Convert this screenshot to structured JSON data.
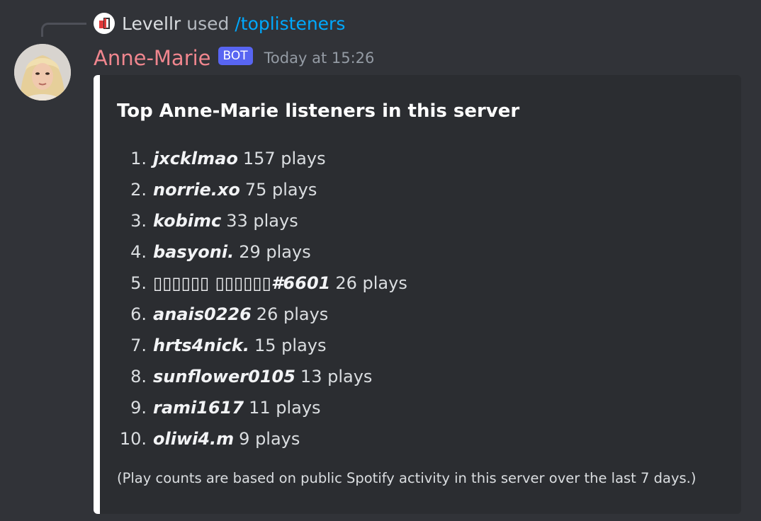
{
  "interaction": {
    "user": "Levellr",
    "verb": "used",
    "command": "/toplisteners"
  },
  "message": {
    "author": "Anne-Marie",
    "badge": "BOT",
    "timestamp": "Today at 15:26"
  },
  "embed": {
    "accent_color": "#ffffff",
    "title": "Top Anne-Marie listeners in this server",
    "entries": [
      {
        "rank": "1.",
        "user": "jxcklmao",
        "plays": "157 plays"
      },
      {
        "rank": "2.",
        "user": "norrie.xo",
        "plays": "75 plays"
      },
      {
        "rank": "3.",
        "user": "kobimc",
        "plays": "33 plays"
      },
      {
        "rank": "4.",
        "user": "basyoni.",
        "plays": "29 plays"
      },
      {
        "rank": "5.",
        "user": "▯▯▯▯▯▯ ▯▯▯▯▯▯#6601",
        "plays": "26 plays"
      },
      {
        "rank": "6.",
        "user": "anais0226",
        "plays": "26 plays"
      },
      {
        "rank": "7.",
        "user": "hrts4nick.",
        "plays": "15 plays"
      },
      {
        "rank": "8.",
        "user": "sunflower0105",
        "plays": "13 plays"
      },
      {
        "rank": "9.",
        "user": "rami1617",
        "plays": "11 plays"
      },
      {
        "rank": "10.",
        "user": "oliwi4.m",
        "plays": "9 plays"
      }
    ],
    "footer_note": "(Play counts are based on public Spotify activity in this server over the last 7 days.)"
  },
  "colors": {
    "background": "#313338",
    "embed_background": "#2b2d31",
    "author_name": "#f0868e",
    "badge": "#5865f2",
    "command_link": "#00a8fc"
  },
  "icons": {
    "app_icon": "levellr-logo-icon",
    "avatar": "user-avatar-photo"
  }
}
